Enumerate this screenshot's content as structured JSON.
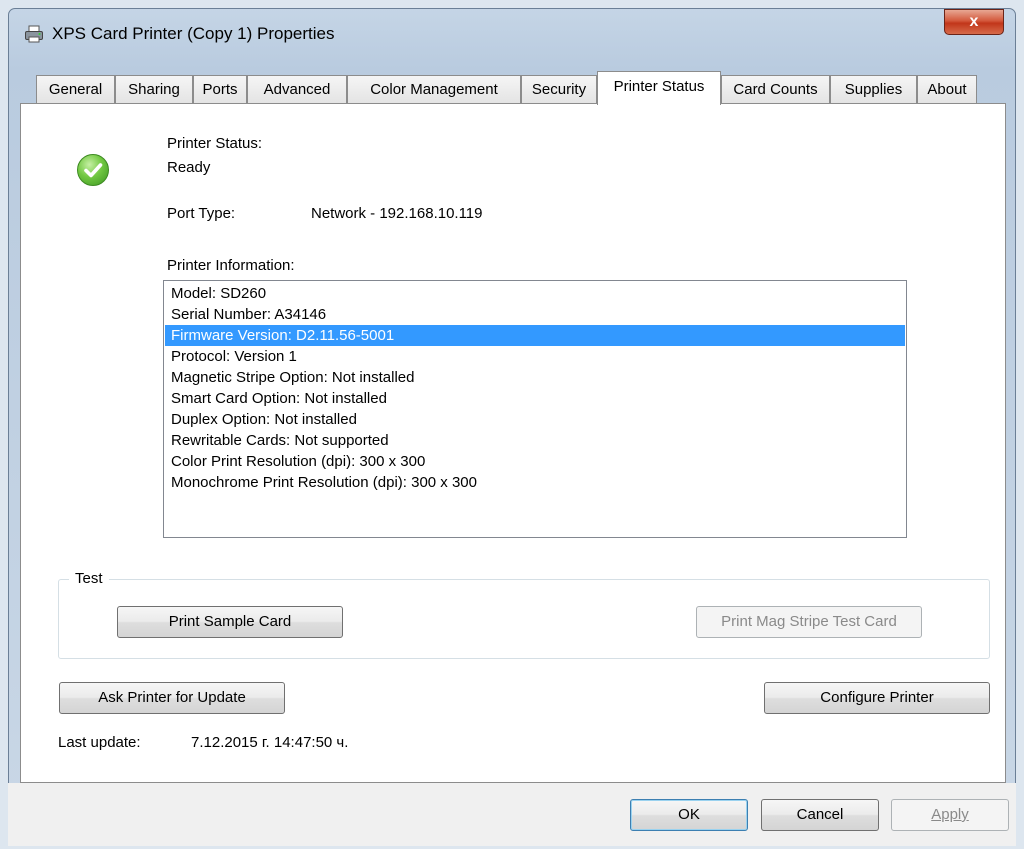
{
  "window": {
    "title": "XPS Card Printer (Copy 1) Properties",
    "close_label": "x"
  },
  "tabs": [
    {
      "label": "General"
    },
    {
      "label": "Sharing"
    },
    {
      "label": "Ports"
    },
    {
      "label": "Advanced"
    },
    {
      "label": "Color Management"
    },
    {
      "label": "Security"
    },
    {
      "label": "Printer Status",
      "active": true
    },
    {
      "label": "Card Counts"
    },
    {
      "label": "Supplies"
    },
    {
      "label": "About"
    }
  ],
  "status": {
    "label": "Printer Status:",
    "value": "Ready",
    "icon": "check-circle-icon",
    "icon_color": "#5fbf3a"
  },
  "port": {
    "label": "Port Type:",
    "value": "Network - 192.168.10.119"
  },
  "printer_info": {
    "label": "Printer Information:",
    "selected_index": 2,
    "items": [
      "Model: SD260",
      "Serial Number: A34146",
      "Firmware Version: D2.11.56-5001",
      "Protocol: Version 1",
      "Magnetic Stripe Option: Not installed",
      "Smart Card Option: Not installed",
      "Duplex Option: Not installed",
      "Rewritable Cards: Not supported",
      "Color Print Resolution (dpi): 300 x 300",
      "Monochrome Print Resolution (dpi): 300 x 300"
    ]
  },
  "test": {
    "legend": "Test",
    "print_sample_label": "Print Sample Card",
    "print_mag_label": "Print Mag Stripe Test Card"
  },
  "actions": {
    "ask_update_label": "Ask Printer for Update",
    "configure_label": "Configure Printer"
  },
  "last_update": {
    "label": "Last update:",
    "value": "7.12.2015 г. 14:47:50 ч."
  },
  "dialog_buttons": {
    "ok": "OK",
    "cancel": "Cancel",
    "apply": "Apply"
  },
  "colors": {
    "selection": "#3399ff",
    "close_button": "#c7452a"
  }
}
